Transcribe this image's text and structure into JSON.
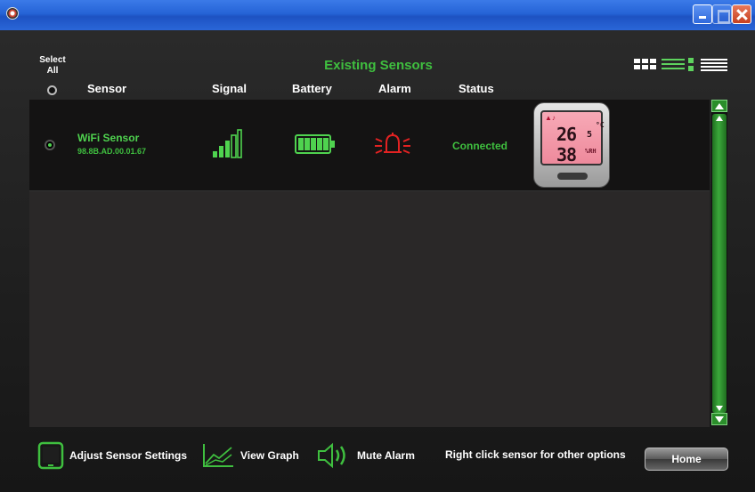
{
  "window": {
    "title": ""
  },
  "header": {
    "select_all": "Select All",
    "heading": "Existing Sensors",
    "columns": {
      "sensor": "Sensor",
      "signal": "Signal",
      "battery": "Battery",
      "alarm": "Alarm",
      "status": "Status"
    }
  },
  "view_modes": [
    "grid-view-icon",
    "detail-view-icon",
    "list-view-icon"
  ],
  "sensors": [
    {
      "name": "WiFi Sensor",
      "mac": "98.8B.AD.00.01.67",
      "status": "Connected",
      "signal_bars": 5,
      "battery_cells": 5,
      "alarm_state": "active",
      "display": {
        "temp_whole": "26",
        "temp_decimal": "5",
        "temp_unit": "°C",
        "humidity": "38",
        "humidity_unit": "%RH"
      }
    }
  ],
  "toolbar": {
    "adjust": "Adjust Sensor Settings",
    "graph": "View Graph",
    "mute": "Mute Alarm",
    "hint": "Right click sensor for other options",
    "home": "Home"
  },
  "colors": {
    "accent_green": "#3fbf3f",
    "alarm_red": "#e32222",
    "titlebar_blue": "#2563d6"
  }
}
